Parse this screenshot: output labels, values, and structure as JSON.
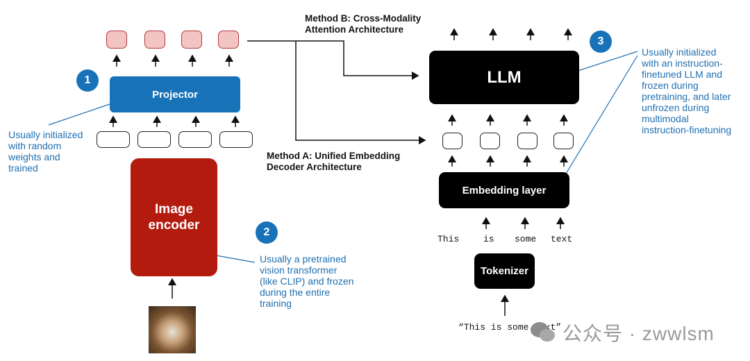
{
  "labels": {
    "projector": "Projector",
    "image_encoder": "Image\nencoder",
    "llm": "LLM",
    "embedding_layer": "Embedding layer",
    "tokenizer": "Tokenizer"
  },
  "badges": [
    "1",
    "2",
    "3"
  ],
  "notes": {
    "projector_note": "Usually initialized\nwith random\nweights and\ntrained",
    "encoder_note": "Usually a pretrained\nvision transformer\n(like CLIP) and frozen\nduring the entire\ntraining",
    "llm_note": "Usually initialized\nwith an instruction-\nfinetuned LLM and\nfrozen during\npretraining, and later\nunfrozen during\nmultimodal\ninstruction-finetuning"
  },
  "methods": {
    "method_b": "Method B: Cross-Modality\nAttention Architecture",
    "method_a": "Method A: Unified Embedding\nDecoder Architecture"
  },
  "tokens": [
    "This",
    "is",
    "some",
    "text"
  ],
  "input_text": "“This is some text”",
  "watermark": {
    "icon": "wechat-icon",
    "text": "公众号 · zwwlsm"
  },
  "colors": {
    "blue": "#1772b8",
    "red": "#b31b0f",
    "pink": "#f2c4c4",
    "black": "#000000"
  }
}
